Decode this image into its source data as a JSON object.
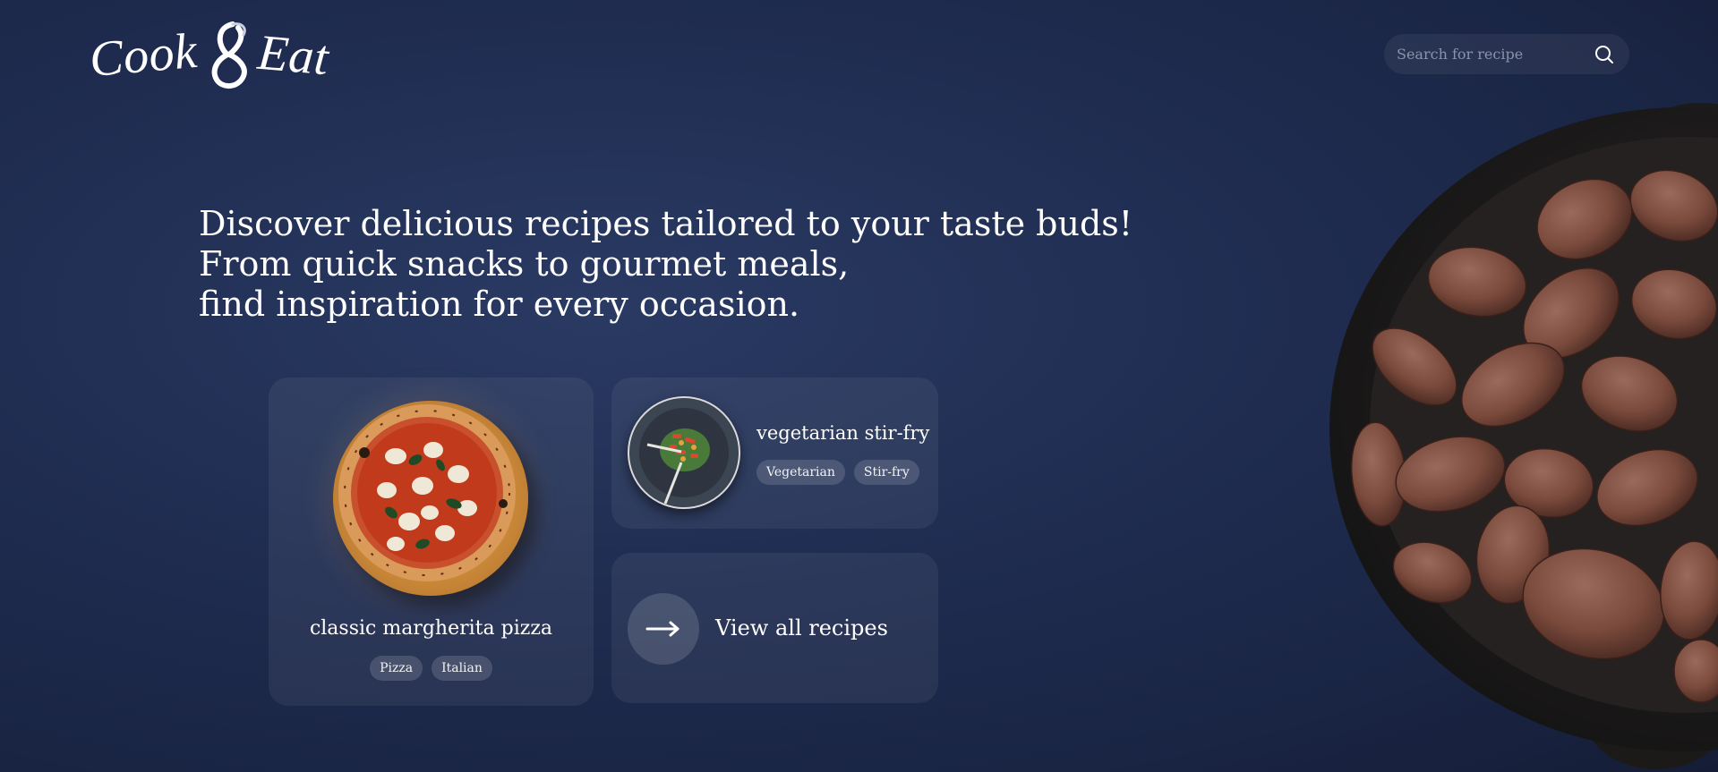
{
  "brand": {
    "name_left": "Cook",
    "name_right": "Eat"
  },
  "search": {
    "placeholder": "Search for recipe"
  },
  "hero": {
    "line1": "Discover delicious recipes tailored to your taste buds!",
    "line2": "From quick snacks to gourmet meals,",
    "line3": "find inspiration for every occasion."
  },
  "recipes": [
    {
      "title": "classic margherita pizza",
      "tags": [
        "Pizza",
        "Italian"
      ]
    },
    {
      "title": "vegetarian stir-fry",
      "tags": [
        "Vegetarian",
        "Stir-fry"
      ]
    }
  ],
  "view_all": {
    "label": "View all recipes"
  },
  "icons": {
    "search": "search-icon",
    "arrow": "arrow-right-icon",
    "logo_amp": "ampersand-logo"
  }
}
